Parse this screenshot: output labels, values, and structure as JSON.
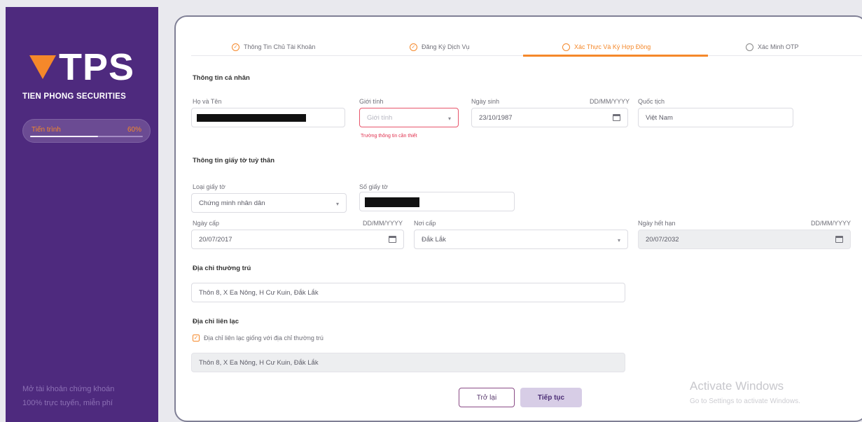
{
  "brand": {
    "logo_text": "TPS",
    "subtitle": "TIEN PHONG SECURITIES",
    "accent": "#f5882a",
    "sidebar_bg": "#4e2a7e"
  },
  "progress": {
    "label": "Tiến trình",
    "percent_text": "60%",
    "value": 0.6
  },
  "sidebar_footer": {
    "line1": "Mở tài khoản chứng khoán",
    "line2": "100% trực tuyến, miễn phí"
  },
  "steps": [
    {
      "label": "Thông Tin Chủ Tài Khoản",
      "state": "done",
      "icon": "check-circle-icon"
    },
    {
      "label": "Đăng Ký Dịch Vụ",
      "state": "done",
      "icon": "check-circle-icon"
    },
    {
      "label": "Xác Thực Và Ký Hợp Đồng",
      "state": "active",
      "icon": "circle-icon"
    },
    {
      "label": "Xác Minh OTP",
      "state": "pending",
      "icon": "circle-icon"
    }
  ],
  "personal": {
    "title": "Thông tin cá nhân",
    "fullname_label": "Họ và Tên",
    "gender_label": "Giới tính",
    "gender_placeholder": "Giới tính",
    "gender_error": "Trường thông tin cần thiết",
    "dob_label": "Ngày sinh",
    "dob_format": "DD/MM/YYYY",
    "dob_value": "23/10/1987",
    "nationality_label": "Quốc tịch",
    "nationality_value": "Việt Nam"
  },
  "identity": {
    "title": "Thông tin giấy tờ tuỳ thân",
    "doc_type_label": "Loại giấy tờ",
    "doc_type_value": "Chứng minh nhân dân",
    "doc_number_label": "Số giấy tờ",
    "issue_date_label": "Ngày cấp",
    "issue_date_format": "DD/MM/YYYY",
    "issue_date_value": "20/07/2017",
    "issue_place_label": "Nơi cấp",
    "issue_place_value": "Đắk Lắk",
    "expiry_label": "Ngày hết hạn",
    "expiry_format": "DD/MM/YYYY",
    "expiry_value": "20/07/2032"
  },
  "permanent_address": {
    "title": "Địa chỉ thường trú",
    "value": "Thôn 8, X Ea Nông, H Cư Kuin, Đắk Lắk"
  },
  "contact_address": {
    "title": "Địa chỉ liên lạc",
    "same_checkbox_label": "Địa chỉ liên lạc giống với địa chỉ thường trú",
    "checked": true,
    "value": "Thôn 8, X Ea Nông, H Cư Kuin, Đắk Lắk"
  },
  "buttons": {
    "back": "Trở lại",
    "next": "Tiếp tục"
  },
  "watermark": {
    "title": "Activate Windows",
    "subtitle": "Go to Settings to activate Windows."
  }
}
